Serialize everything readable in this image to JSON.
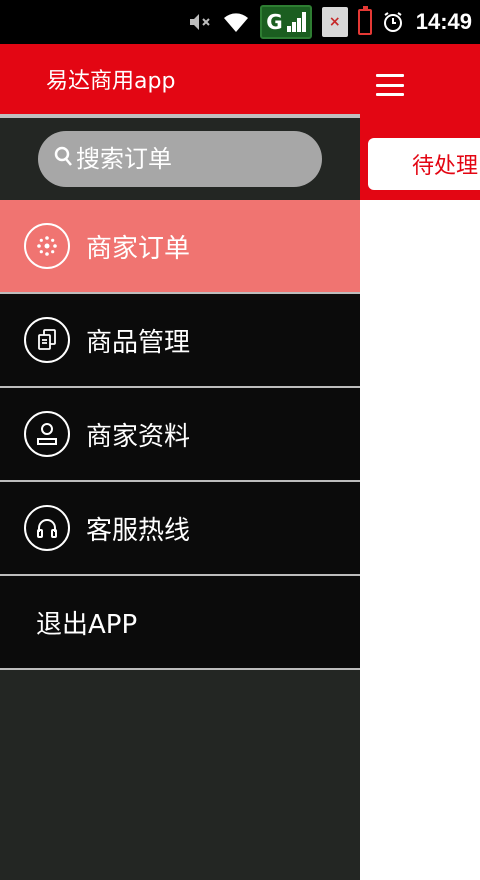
{
  "status_bar": {
    "time": "14:49",
    "network": "G",
    "sim_badge": "×",
    "icons": [
      "mute-icon",
      "wifi-icon",
      "signal-icon",
      "sim-icon",
      "battery-icon",
      "alarm-icon"
    ]
  },
  "drawer": {
    "title": "易达商用app",
    "search": {
      "placeholder": "搜索订单"
    },
    "items": [
      {
        "label": "商家订单",
        "icon": "order-icon",
        "active": true
      },
      {
        "label": "商品管理",
        "icon": "product-icon",
        "active": false
      },
      {
        "label": "商家资料",
        "icon": "profile-icon",
        "active": false
      },
      {
        "label": "客服热线",
        "icon": "headset-icon",
        "active": false
      },
      {
        "label": "退出APP",
        "icon": "",
        "active": false
      }
    ]
  },
  "main": {
    "tab_pending": "待处理"
  },
  "colors": {
    "brand_red": "#e30613",
    "active_item": "#f07471",
    "drawer_bg": "#232623",
    "item_bg": "#0b0b0b"
  }
}
